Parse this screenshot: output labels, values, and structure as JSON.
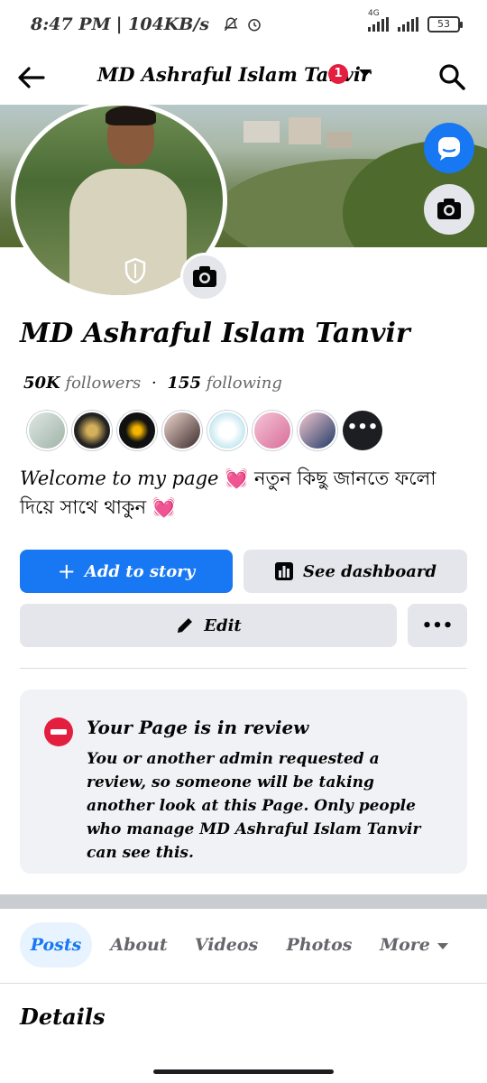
{
  "status_bar": {
    "time": "8:47 PM",
    "speed": "| 104KB/s",
    "network_type": "4G",
    "battery": "53"
  },
  "header": {
    "title": "MD Ashraful Islam Tanvir",
    "notification_count": "1"
  },
  "profile": {
    "name": "MD Ashraful Islam Tanvir",
    "followers_count": "50K",
    "followers_label": "followers",
    "separator": "·",
    "following_count": "155",
    "following_label": "following",
    "more_followers_glyph": "•••",
    "bio_en": "Welcome to my page",
    "bio_bn": "নতুন কিছু জানতে ফলো দিয়ে সাথে থাকুন",
    "bio_emoji": "💓"
  },
  "actions": {
    "add_story_icon": "+",
    "add_story": "Add to story",
    "see_dashboard": "See dashboard",
    "edit": "Edit",
    "more": "•••"
  },
  "review_notice": {
    "title": "Your Page is in review",
    "body": "You or another admin requested a review, so someone will be taking another look at this Page. Only people who manage MD Ashraful Islam Tanvir can see this."
  },
  "tabs": [
    {
      "label": "Posts",
      "active": true
    },
    {
      "label": "About",
      "active": false
    },
    {
      "label": "Videos",
      "active": false
    },
    {
      "label": "Photos",
      "active": false
    },
    {
      "label": "More",
      "active": false
    }
  ],
  "details": {
    "heading": "Details"
  },
  "colors": {
    "primary": "#1877f2",
    "badge": "#e41e3f",
    "review_icon": "#e41e3f",
    "button_gray": "#e4e6eb",
    "muted_text": "#65676b"
  },
  "icons": [
    "back-arrow-icon",
    "search-icon",
    "messenger-icon",
    "camera-icon",
    "shield-icon",
    "dashboard-icon",
    "pencil-icon",
    "no-entry-icon",
    "caret-down-icon"
  ]
}
